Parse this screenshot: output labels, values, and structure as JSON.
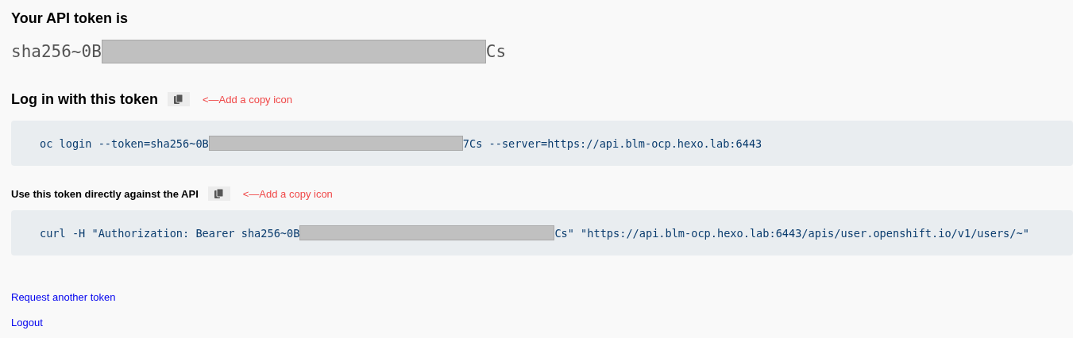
{
  "title": "Your API token is",
  "token": {
    "start": "sha256~0B",
    "end": "Cs"
  },
  "sections": [
    {
      "heading": "Log in with this token",
      "kind": "main",
      "note": "<—Add a copy icon",
      "command": {
        "start": "oc login --token=sha256~0B",
        "end": "7Cs --server=https://api.blm-ocp.hexo.lab:6443"
      }
    },
    {
      "heading": "Use this token directly against the API",
      "kind": "sub",
      "note": "<—Add a copy icon",
      "command": {
        "start": "curl -H \"Authorization: Bearer sha256~0B",
        "end": "Cs\" \"https://api.blm-ocp.hexo.lab:6443/apis/user.openshift.io/v1/users/~\""
      }
    }
  ],
  "links": [
    "Request another token",
    "Logout"
  ]
}
